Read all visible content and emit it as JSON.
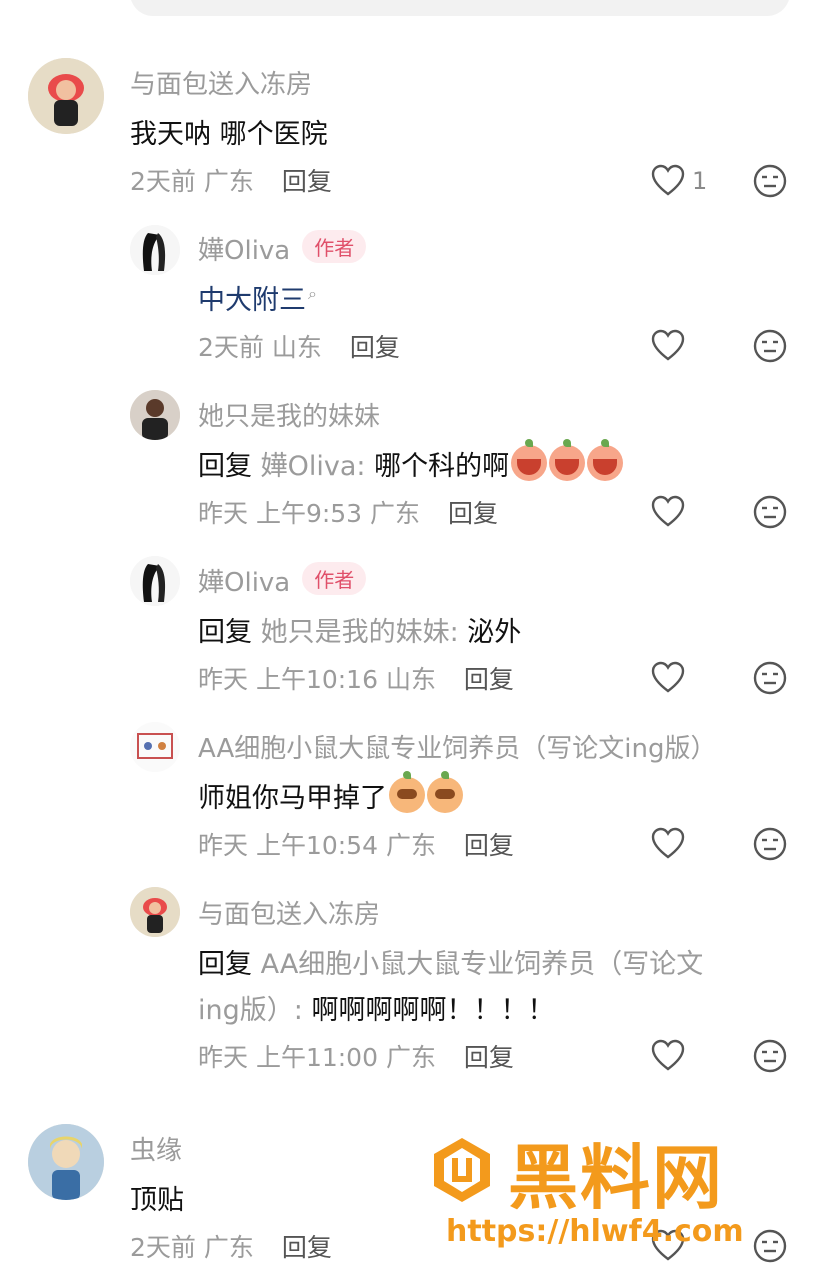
{
  "comments": [
    {
      "user": "与面包送入冻房",
      "text": "我天呐 哪个医院",
      "time": "2天前",
      "location": "广东",
      "reply_label": "回复",
      "likes": "1"
    },
    {
      "user": "嬅Oliva",
      "badge": "作者",
      "text": "中大附三",
      "time": "2天前",
      "location": "山东",
      "reply_label": "回复"
    },
    {
      "user": "她只是我的妹妹",
      "reply_prefix": "回复",
      "reply_target": "嬅Oliva:",
      "text": "哪个科的啊",
      "time": "昨天 上午9:53",
      "location": "广东",
      "reply_label": "回复"
    },
    {
      "user": "嬅Oliva",
      "badge": "作者",
      "reply_prefix": "回复",
      "reply_target": "她只是我的妹妹:",
      "text": "泌外",
      "time": "昨天 上午10:16",
      "location": "山东",
      "reply_label": "回复"
    },
    {
      "user": "AA细胞小鼠大鼠专业饲养员（写论文ing版）",
      "text": "师姐你马甲掉了",
      "time": "昨天 上午10:54",
      "location": "广东",
      "reply_label": "回复"
    },
    {
      "user": "与面包送入冻房",
      "reply_prefix": "回复",
      "reply_target_line1": "AA细胞小鼠大鼠专业饲养员（写论文",
      "reply_target_line2": "ing版）:",
      "text": "啊啊啊啊啊！！！！",
      "time": "昨天 上午11:00",
      "location": "广东",
      "reply_label": "回复"
    },
    {
      "user": "虫缘",
      "text": "顶贴",
      "time": "2天前",
      "location": "广东",
      "reply_label": "回复"
    }
  ],
  "watermark": {
    "title": "黑料网",
    "url": "https://hlwf4.com"
  },
  "icons": {
    "like": "heart-outline-icon",
    "dislike": "meh-face-icon"
  },
  "colors": {
    "author_badge": "#e0506a",
    "watermark": "#f39a1c"
  }
}
